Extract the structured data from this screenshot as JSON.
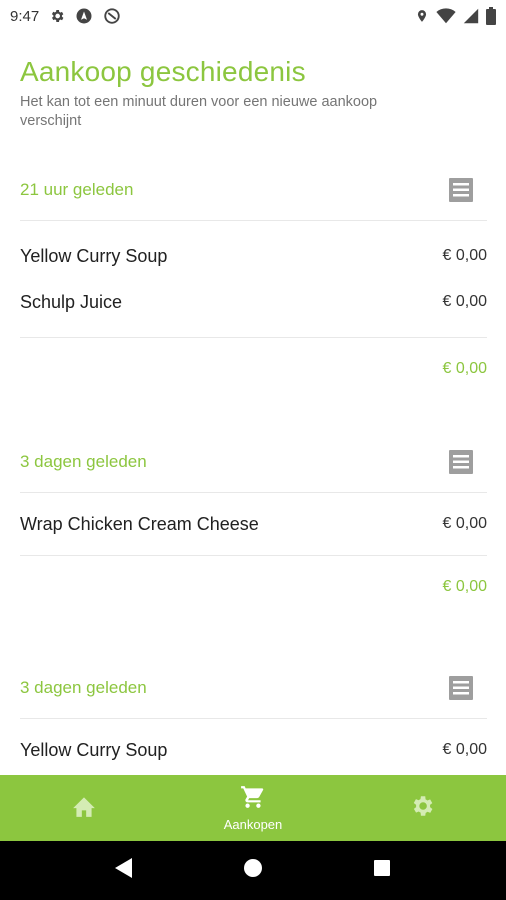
{
  "status_bar": {
    "time": "9:47",
    "icons_left": [
      "gear-icon",
      "nav-arrow-icon",
      "do-not-disturb-icon"
    ],
    "icons_right": [
      "location-icon",
      "wifi-icon",
      "signal-icon",
      "battery-icon"
    ]
  },
  "page": {
    "title": "Aankoop geschiedenis",
    "subtitle": "Het kan tot een minuut duren voor een nieuwe aankoop verschijnt"
  },
  "purchases": [
    {
      "date": "21 uur geleden",
      "items": [
        {
          "name": "Yellow Curry Soup",
          "price": "€ 0,00"
        },
        {
          "name": "Schulp Juice",
          "price": "€ 0,00"
        }
      ],
      "total": "€ 0,00"
    },
    {
      "date": "3 dagen geleden",
      "items": [
        {
          "name": "Wrap Chicken Cream Cheese",
          "price": "€ 0,00"
        }
      ],
      "total": "€ 0,00"
    },
    {
      "date": "3 dagen geleden",
      "items": [
        {
          "name": "Yellow Curry Soup",
          "price": "€ 0,00"
        }
      ],
      "total": ""
    }
  ],
  "bottom_nav": {
    "items": [
      {
        "icon": "home-icon",
        "label": ""
      },
      {
        "icon": "cart-icon",
        "label": "Aankopen"
      },
      {
        "icon": "gear-icon",
        "label": ""
      }
    ],
    "active_index": 1
  },
  "colors": {
    "accent": "#8cc63f",
    "active_nav": "#ffffff",
    "inactive_nav": "#d4ecb4"
  }
}
